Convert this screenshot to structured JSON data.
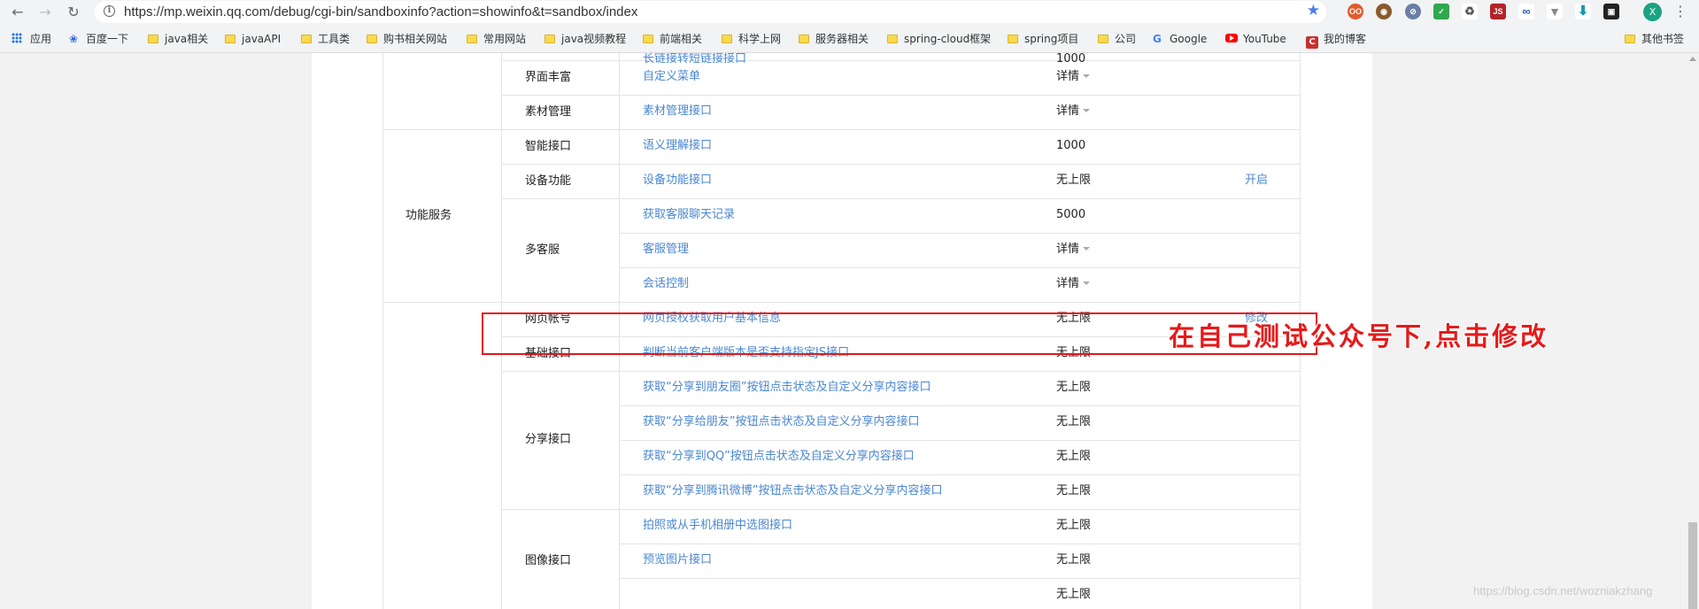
{
  "browser": {
    "url": "https://mp.weixin.qq.com/debug/cgi-bin/sandboxinfo?action=showinfo&t=sandbox/index",
    "profile_initial": "X"
  },
  "bookmarks": {
    "items": [
      "应用",
      "百度一下",
      "java相关",
      "javaAPI",
      "工具类",
      "购书相关网站",
      "常用网站",
      "java视频教程",
      "前端相关",
      "科学上网",
      "服务器相关",
      "spring-cloud框架",
      "spring项目",
      "公司",
      "Google",
      "YouTube",
      "我的博客"
    ],
    "other": "其他书签"
  },
  "table": {
    "top_partial": {
      "link": "长链接转短链接接口",
      "value": "1000"
    },
    "rows": [
      {
        "category": "",
        "sub": "界面丰富",
        "link": "自定义菜单",
        "value": "详情",
        "caret": true,
        "op": ""
      },
      {
        "category": "",
        "sub": "素材管理",
        "link": "素材管理接口",
        "value": "详情",
        "caret": true,
        "op": ""
      },
      {
        "category": "",
        "sub": "智能接口",
        "link": "语义理解接口",
        "value": "1000",
        "caret": false,
        "op": ""
      },
      {
        "category": "功能服务",
        "sub": "设备功能",
        "link": "设备功能接口",
        "value": "无上限",
        "caret": false,
        "op": "开启"
      },
      {
        "category": "",
        "sub": "",
        "link": "获取客服聊天记录",
        "value": "5000",
        "caret": false,
        "op": ""
      },
      {
        "category": "",
        "sub": "多客服",
        "link": "客服管理",
        "value": "详情",
        "caret": true,
        "op": ""
      },
      {
        "category": "",
        "sub": "",
        "link": "会话控制",
        "value": "详情",
        "caret": true,
        "op": ""
      },
      {
        "category": "",
        "sub": "网页帐号",
        "link": "网页授权获取用户基本信息",
        "value": "无上限",
        "caret": false,
        "op": "修改"
      },
      {
        "category": "",
        "sub": "基础接口",
        "link": "判断当前客户端版本是否支持指定JS接口",
        "value": "无上限",
        "caret": false,
        "op": ""
      },
      {
        "category": "",
        "sub": "",
        "link": "获取“分享到朋友圈”按钮点击状态及自定义分享内容接口",
        "value": "无上限",
        "caret": false,
        "op": ""
      },
      {
        "category": "",
        "sub": "",
        "link": "获取“分享给朋友”按钮点击状态及自定义分享内容接口",
        "value": "无上限",
        "caret": false,
        "op": ""
      },
      {
        "category": "",
        "sub": "分享接口",
        "link": "获取“分享到QQ”按钮点击状态及自定义分享内容接口",
        "value": "无上限",
        "caret": false,
        "op": ""
      },
      {
        "category": "",
        "sub": "",
        "link": "获取“分享到腾讯微博”按钮点击状态及自定义分享内容接口",
        "value": "无上限",
        "caret": false,
        "op": ""
      },
      {
        "category": "",
        "sub": "",
        "link": "拍照或从手机相册中选图接口",
        "value": "无上限",
        "caret": false,
        "op": ""
      },
      {
        "category": "",
        "sub": "",
        "link": "预览图片接口",
        "value": "无上限",
        "caret": false,
        "op": ""
      },
      {
        "category": "",
        "sub": "图像接口",
        "link": "",
        "value": "无上限",
        "caret": false,
        "op": ""
      }
    ]
  },
  "annotation": "在自己测试公众号下,点击修改",
  "watermark": "https://blog.csdn.net/wozniakzhang",
  "colors": {
    "link": "#4a87d2",
    "highlight": "#e0191c",
    "annotation": "#e51a1a"
  }
}
